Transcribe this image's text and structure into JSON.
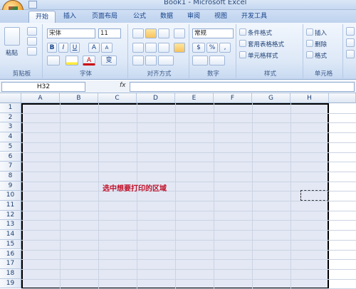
{
  "window": {
    "title": "Book1 - Microsoft Excel"
  },
  "tabs": [
    {
      "label": "开始"
    },
    {
      "label": "插入"
    },
    {
      "label": "页面布局"
    },
    {
      "label": "公式"
    },
    {
      "label": "数据"
    },
    {
      "label": "审阅"
    },
    {
      "label": "视图"
    },
    {
      "label": "开发工具"
    }
  ],
  "ribbon": {
    "clipboard": {
      "label": "剪贴板",
      "paste": "粘贴"
    },
    "font": {
      "label": "字体",
      "name": "宋体",
      "size": "11",
      "bold": "B",
      "italic": "I",
      "underline": "U",
      "grow": "A",
      "shrink": "A",
      "color": "A",
      "phonetic": "变"
    },
    "alignment": {
      "label": "对齐方式"
    },
    "number": {
      "label": "数字",
      "format": "常规",
      "currency": "$",
      "percent": "%",
      "comma": ","
    },
    "styles": {
      "label": "样式",
      "conditional": "条件格式",
      "table": "套用表格格式",
      "cell": "单元格样式"
    },
    "cells": {
      "label": "单元格",
      "insert": "插入",
      "delete": "删除",
      "format": "格式"
    }
  },
  "formula_bar": {
    "name_box": "H32",
    "fx": "fx"
  },
  "sheet": {
    "columns": [
      "A",
      "B",
      "C",
      "D",
      "E",
      "F",
      "G",
      "H"
    ],
    "rows": [
      "1",
      "2",
      "3",
      "4",
      "5",
      "6",
      "7",
      "8",
      "9",
      "10",
      "11",
      "12",
      "13",
      "14",
      "15",
      "16",
      "17",
      "18",
      "19"
    ],
    "annotation": "选中想要打印的区域"
  }
}
